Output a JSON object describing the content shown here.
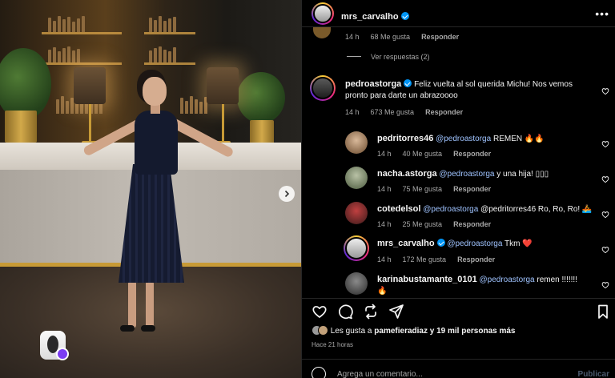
{
  "post": {
    "author": "mrs_carvalho"
  },
  "top_reply_meta": {
    "time": "14 h",
    "likes": "68 Me gusta",
    "reply": "Responder"
  },
  "see_replies": "Ver respuestas (2)",
  "comments": [
    {
      "user": "pedroastorga",
      "verified": true,
      "text": "Feliz vuelta al sol querida Michu! Nos vemos pronto para darte un abrazoooo",
      "time": "14 h",
      "likes": "673 Me gusta",
      "reply": "Responder"
    }
  ],
  "replies": [
    {
      "user": "pedritorres46",
      "mention": "@pedroastorga",
      "text": "REMEN 🔥🔥",
      "time": "14 h",
      "likes": "40 Me gusta",
      "reply": "Responder"
    },
    {
      "user": "nacha.astorga",
      "mention": "@pedroastorga",
      "text": "y una hija! ▯▯▯",
      "time": "14 h",
      "likes": "75 Me gusta",
      "reply": "Responder"
    },
    {
      "user": "cotedelsol",
      "mention": "@pedroastorga",
      "text": "@pedritorres46 Ro, Ro, Ro! 🚣",
      "time": "14 h",
      "likes": "25 Me gusta",
      "reply": "Responder"
    },
    {
      "user": "mrs_carvalho",
      "verified": true,
      "mention": "@pedroastorga",
      "text": "Tkm ❤️",
      "time": "14 h",
      "likes": "172 Me gusta",
      "reply": "Responder"
    },
    {
      "user": "karinabustamante_0101",
      "mention": "@pedroastorga",
      "text": "remen !!!!!!!",
      "extra": "🔥"
    }
  ],
  "likes_summary": {
    "prefix": "Les gusta a",
    "user": "pamefieradiaz",
    "suffix": "y 19 mil personas más"
  },
  "date": "Hace 21 horas",
  "add_comment": {
    "placeholder": "Agrega un comentario...",
    "publish": "Publicar"
  },
  "colors": {
    "accent": "#0095f6",
    "background": "#000000",
    "muted": "#a8a8a8"
  },
  "icons": [
    "more-icon",
    "heart-icon",
    "comment-icon",
    "repost-icon",
    "share-icon",
    "bookmark-icon",
    "emoji-icon",
    "chevron-right-icon"
  ]
}
